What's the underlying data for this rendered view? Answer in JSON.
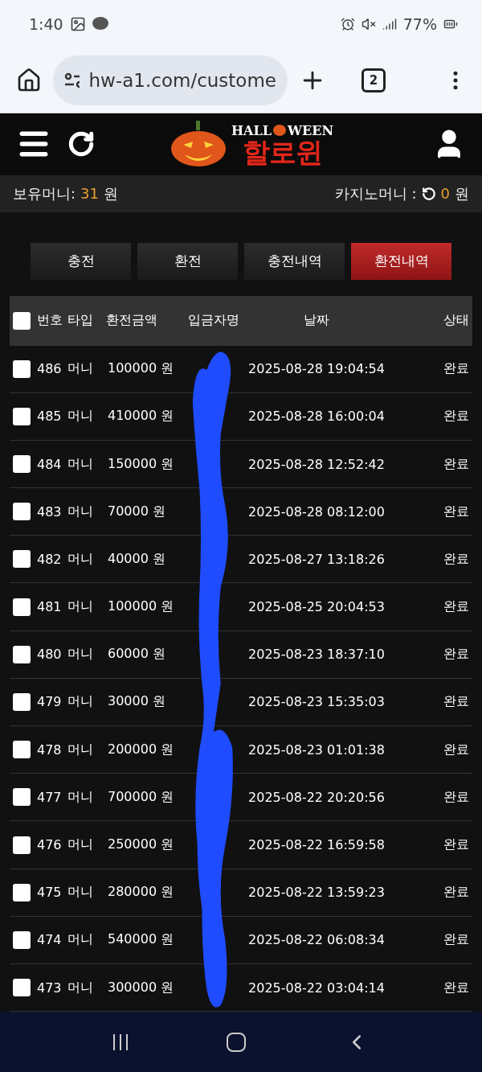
{
  "status_bar": {
    "time": "1:40",
    "battery": "77%"
  },
  "browser": {
    "url": "hw-a1.com/custome",
    "tab_count": "2"
  },
  "header": {
    "logo_top_left": "HALL",
    "logo_top_right": "WEEN",
    "logo_main": "할로윈"
  },
  "balance": {
    "label": "보유머니:",
    "amount": "31",
    "unit": "원",
    "casino_label": "카지노머니 :",
    "casino_amount": "0",
    "casino_unit": "원"
  },
  "tabs": [
    {
      "label": "충전",
      "selected": false
    },
    {
      "label": "환전",
      "selected": false
    },
    {
      "label": "충전내역",
      "selected": false
    },
    {
      "label": "환전내역",
      "selected": true
    }
  ],
  "table": {
    "select_all_checked": false,
    "columns": [
      "번호",
      "타입",
      "환전금액",
      "입금자명",
      "날짜",
      "상태"
    ],
    "rows": [
      {
        "number": "486",
        "type": "머니",
        "amount": "100000 원",
        "date": "2025-08-28 19:04:54",
        "status": "완료",
        "checked": false
      },
      {
        "number": "485",
        "type": "머니",
        "amount": "410000 원",
        "date": "2025-08-28 16:00:04",
        "status": "완료",
        "checked": false
      },
      {
        "number": "484",
        "type": "머니",
        "amount": "150000 원",
        "date": "2025-08-28 12:52:42",
        "status": "완료",
        "checked": false
      },
      {
        "number": "483",
        "type": "머니",
        "amount": "70000 원",
        "date": "2025-08-28 08:12:00",
        "status": "완료",
        "checked": false
      },
      {
        "number": "482",
        "type": "머니",
        "amount": "40000 원",
        "date": "2025-08-27 13:18:26",
        "status": "완료",
        "checked": false
      },
      {
        "number": "481",
        "type": "머니",
        "amount": "100000 원",
        "date": "2025-08-25 20:04:53",
        "status": "완료",
        "checked": false
      },
      {
        "number": "480",
        "type": "머니",
        "amount": "60000 원",
        "date": "2025-08-23 18:37:10",
        "status": "완료",
        "checked": false
      },
      {
        "number": "479",
        "type": "머니",
        "amount": "30000 원",
        "date": "2025-08-23 15:35:03",
        "status": "완료",
        "checked": false
      },
      {
        "number": "478",
        "type": "머니",
        "amount": "200000 원",
        "date": "2025-08-23 01:01:38",
        "status": "완료",
        "checked": false
      },
      {
        "number": "477",
        "type": "머니",
        "amount": "700000 원",
        "date": "2025-08-22 20:20:56",
        "status": "완료",
        "checked": false
      },
      {
        "number": "476",
        "type": "머니",
        "amount": "250000 원",
        "date": "2025-08-22 16:59:58",
        "status": "완료",
        "checked": false
      },
      {
        "number": "475",
        "type": "머니",
        "amount": "280000 원",
        "date": "2025-08-22 13:59:23",
        "status": "완료",
        "checked": false
      },
      {
        "number": "474",
        "type": "머니",
        "amount": "540000 원",
        "date": "2025-08-22 06:08:34",
        "status": "완료",
        "checked": false
      },
      {
        "number": "473",
        "type": "머니",
        "amount": "300000 원",
        "date": "2025-08-22 03:04:14",
        "status": "완료",
        "checked": false
      }
    ]
  }
}
